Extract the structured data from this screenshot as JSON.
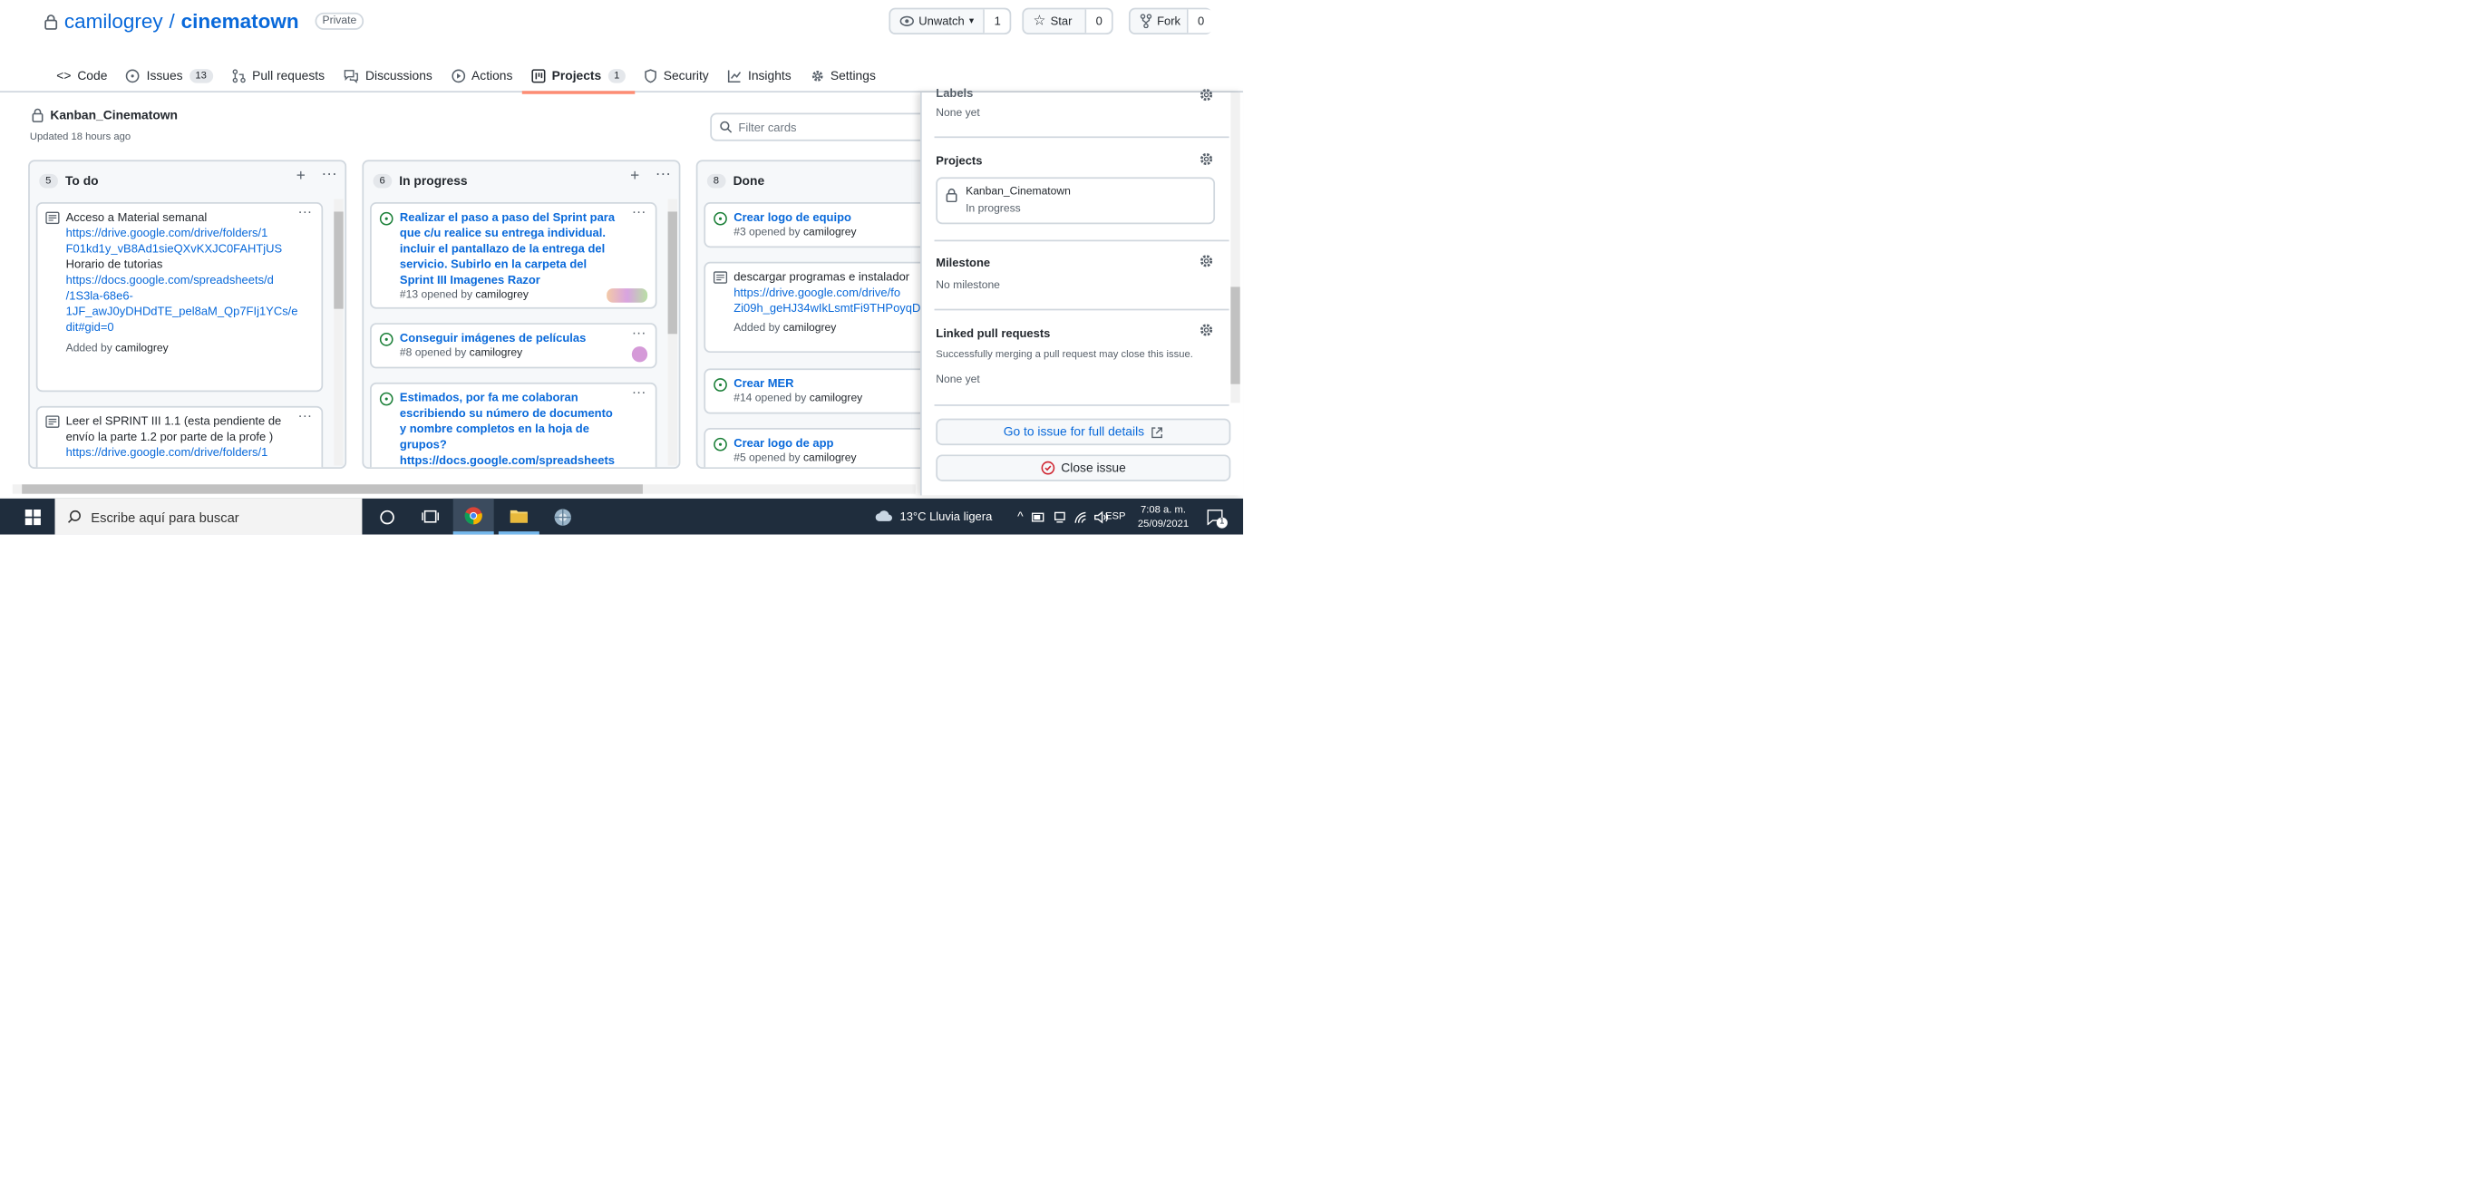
{
  "repo": {
    "owner": "camilogrey",
    "separator": "/",
    "name": "cinematown",
    "visibility": "Private",
    "unwatch_label": "Unwatch",
    "unwatch_count": "1",
    "star_label": "Star",
    "star_count": "0",
    "fork_label": "Fork",
    "fork_count": "0"
  },
  "tabs": [
    {
      "label": "Code",
      "icon": "code-icon"
    },
    {
      "label": "Issues",
      "icon": "issue-icon",
      "count": "13"
    },
    {
      "label": "Pull requests",
      "icon": "pull-request-icon"
    },
    {
      "label": "Discussions",
      "icon": "discussion-icon"
    },
    {
      "label": "Actions",
      "icon": "play-icon"
    },
    {
      "label": "Projects",
      "icon": "project-icon",
      "count": "1",
      "selected": true
    },
    {
      "label": "Security",
      "icon": "shield-icon"
    },
    {
      "label": "Insights",
      "icon": "graph-icon"
    },
    {
      "label": "Settings",
      "icon": "gear-icon"
    }
  ],
  "project": {
    "name": "Kanban_Cinematown",
    "updated": "Updated 18 hours ago",
    "filter_placeholder": "Filter cards"
  },
  "columns": [
    {
      "count": "5",
      "title": "To do",
      "cards": [
        {
          "title": "Acceso a Material semanal",
          "lines": [
            "https://drive.google.com/drive/folders/1",
            "F01kd1y_vB8Ad1sieQXvKXJC0FAHTjUS"
          ],
          "line2": "Horario de tutorias",
          "lines2": [
            "https://docs.google.com/spreadsheets/d",
            "/1S3la-68e6-",
            "1JF_awJ0yDHDdTE_pel8aM_Qp7FIj1YCs/e",
            "dit#gid=0"
          ],
          "added": "Added by",
          "user": "camilogrey"
        },
        {
          "title": "Leer el SPRINT III 1.1 (esta pendiente de",
          "title2": "envío la parte 1.2 por parte de la profe )",
          "link": "https://drive.google.com/drive/folders/1"
        }
      ]
    },
    {
      "count": "6",
      "title": "In progress",
      "cards": [
        {
          "title_lines": [
            "Realizar el paso a paso del Sprint para",
            "que c/u realice su entrega individual.",
            "incluir el pantallazo de la entrega del",
            "servicio. Subirlo en la carpeta del",
            "Sprint III Imagenes Razor"
          ],
          "meta": "#13 opened by",
          "user": "camilogrey"
        },
        {
          "title_lines": [
            "Conseguir imágenes de películas"
          ],
          "meta": "#8 opened by",
          "user": "camilogrey"
        },
        {
          "title_lines": [
            "Estimados, por fa me colaboran",
            "escribiendo su número de documento",
            "y nombre completos en la hoja de",
            "grupos?",
            "https://docs.google.com/spreadsheets"
          ]
        }
      ]
    },
    {
      "count": "8",
      "title": "Done",
      "cards": [
        {
          "title": "Crear logo de equipo",
          "meta": "#3 opened by",
          "user": "camilogrey"
        },
        {
          "note": "descargar programas e instalador",
          "lines": [
            "https://drive.google.com/drive/fo",
            "Zi09h_geHJ34wIkLsmtFi9THPoyqD"
          ],
          "added": "Added by",
          "user": "camilogrey"
        },
        {
          "title": "Crear MER",
          "meta": "#14 opened by",
          "user": "camilogrey"
        },
        {
          "title": "Crear logo de app",
          "meta": "#5 opened by",
          "user": "camilogrey"
        }
      ]
    }
  ],
  "sidebar": {
    "labels_heading": "Labels",
    "labels_value": "None yet",
    "projects_heading": "Projects",
    "project_name": "Kanban_Cinematown",
    "project_status": "In progress",
    "milestone_heading": "Milestone",
    "milestone_value": "No milestone",
    "linked_heading": "Linked pull requests",
    "linked_desc": "Successfully merging a pull request may close this issue.",
    "linked_value": "None yet",
    "goto_label": "Go to issue for full details",
    "close_label": "Close issue"
  },
  "taskbar": {
    "search_placeholder": "Escribe aquí para buscar",
    "weather": "13°C  Lluvia ligera",
    "lang": "ESP",
    "time": "7:08 a. m.",
    "date": "25/09/2021",
    "notifications": "1"
  },
  "colors": {
    "link": "#0969da",
    "open": "#1a7f37",
    "close": "#cf222e",
    "accent": "#fd8c73"
  }
}
